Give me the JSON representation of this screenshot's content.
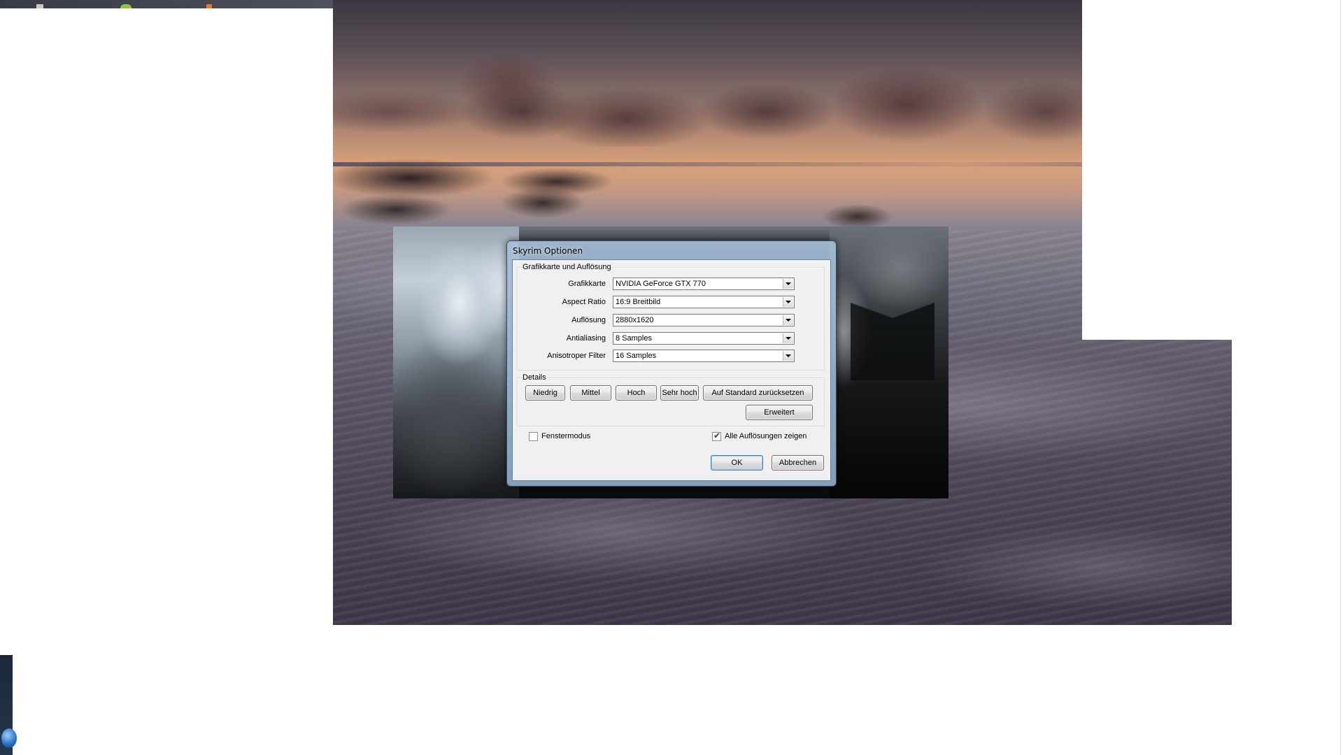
{
  "dialog": {
    "title": "Skyrim Optionen",
    "graphics_group": {
      "legend": "Grafikkarte und Auflösung",
      "rows": [
        {
          "label": "Grafikkarte",
          "value": "NVIDIA GeForce GTX 770"
        },
        {
          "label": "Aspect Ratio",
          "value": "16:9 Breitbild"
        },
        {
          "label": "Auflösung",
          "value": "2880x1620"
        },
        {
          "label": "Antialiasing",
          "value": "8 Samples"
        },
        {
          "label": "Anisotroper Filter",
          "value": "16 Samples"
        }
      ]
    },
    "details_group": {
      "legend": "Details",
      "buttons": {
        "low": "Niedrig",
        "medium": "Mittel",
        "high": "Hoch",
        "ultra": "Sehr hoch",
        "reset": "Auf Standard zurücksetzen",
        "advanced": "Erweitert"
      }
    },
    "checkboxes": {
      "windowed": {
        "label": "Fenstermodus",
        "checked": false
      },
      "all_resolutions": {
        "label": "Alle Auflösungen zeigen",
        "checked": true
      }
    },
    "ok_label": "OK",
    "cancel_label": "Abbrechen"
  },
  "colors": {
    "dialog_frame": "#a5bed7",
    "client_bg": "#f0f0f0",
    "default_button_border": "#3c7fb1"
  }
}
